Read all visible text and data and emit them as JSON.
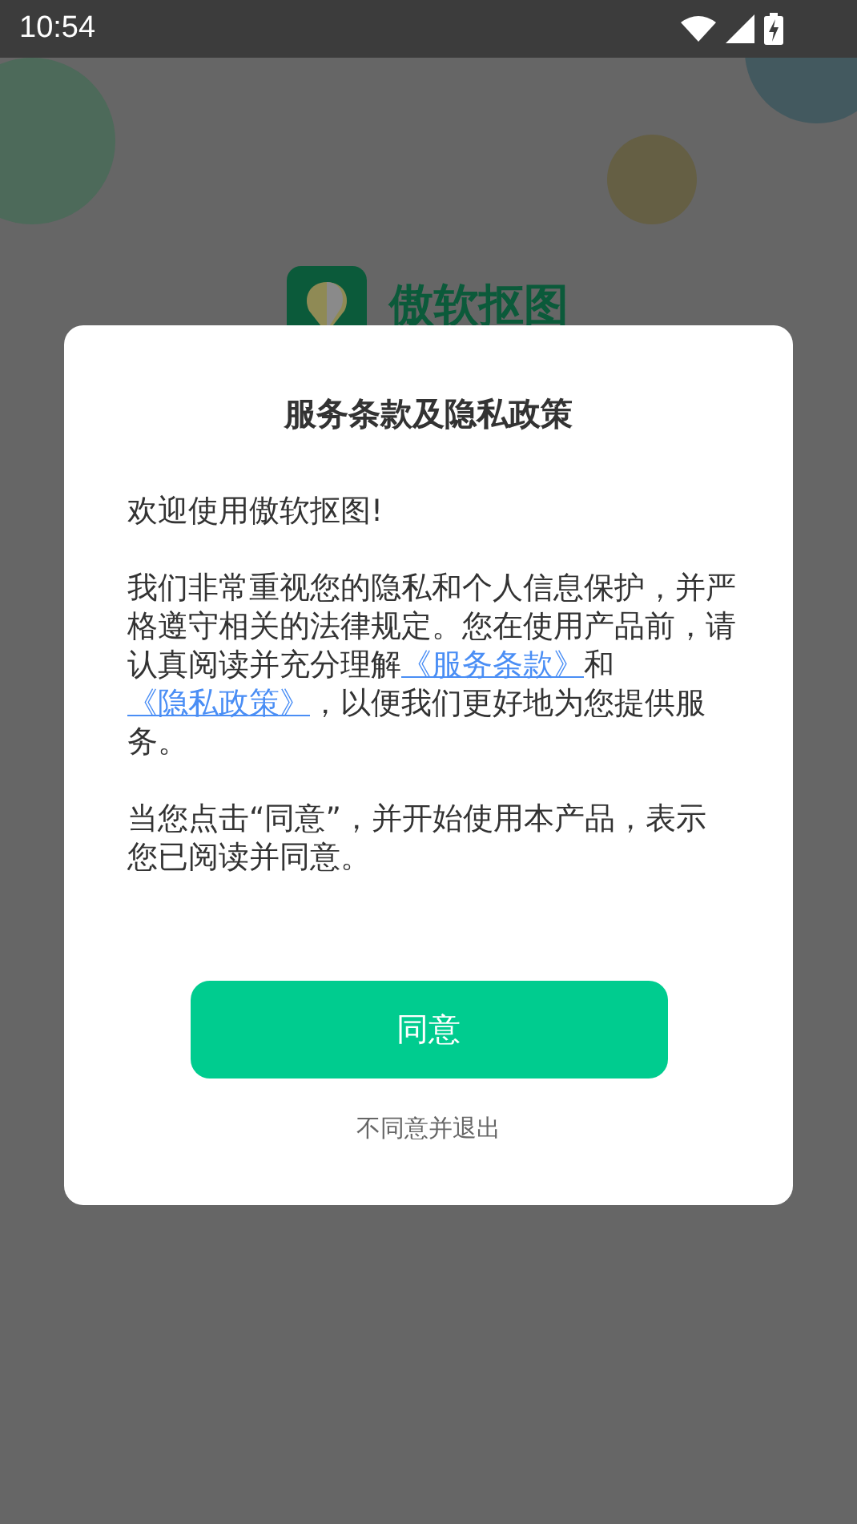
{
  "status_bar": {
    "time": "10:54"
  },
  "app": {
    "name": "傲软抠图"
  },
  "dialog": {
    "title": "服务条款及隐私政策",
    "paragraphs": [
      [
        {
          "kind": "text",
          "text": "欢迎使用傲软抠图!"
        }
      ],
      [
        {
          "kind": "text",
          "text": "我们非常重视您的隐私和个人信息保护，并严格遵守相关的法律规定。您在使用产品前，请认真阅读并充分理解"
        },
        {
          "kind": "link",
          "text": "《服务条款》"
        },
        {
          "kind": "text",
          "text": "和"
        },
        {
          "kind": "link",
          "text": "《隐私政策》"
        },
        {
          "kind": "text",
          "text": "，以便我们更好地为您提供服务。"
        }
      ],
      [
        {
          "kind": "text",
          "text": "当您点击“同意”，并开始使用本产品，表示您已阅读并同意。"
        }
      ]
    ],
    "agree_button": "同意",
    "decline_link": "不同意并退出"
  }
}
